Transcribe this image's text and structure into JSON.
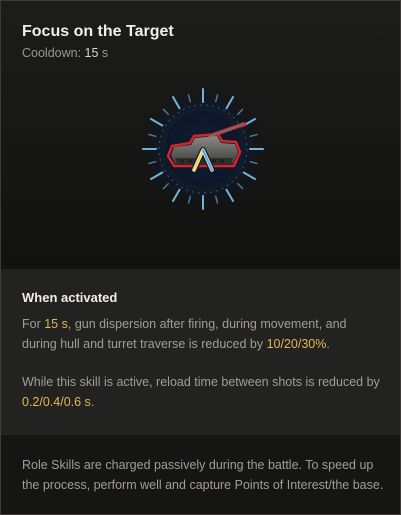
{
  "skill": {
    "title": "Focus on the Target",
    "cooldown_label": "Cooldown: ",
    "cooldown_value": "15",
    "cooldown_unit": " s",
    "icon": "tank-target-icon"
  },
  "activated": {
    "heading": "When activated",
    "para1": {
      "t1": "For ",
      "h1": "15 s",
      "t2": ", gun dispersion after firing, during movement, and during hull and turret traverse is reduced by ",
      "h2": "10/20/30%",
      "t3": "."
    },
    "para2": {
      "t1": "While this skill is active, reload time between shots is reduced by ",
      "h1": "0.2/0.4/0.6 s",
      "t2": "."
    }
  },
  "footer": {
    "text": "Role Skills are charged passively during the battle. To speed up the process, perform well and capture Points of Interest/the base."
  },
  "colors": {
    "highlight": "#e3b559",
    "accent_red": "#d8232a",
    "accent_blue": "#6fb7e8"
  }
}
